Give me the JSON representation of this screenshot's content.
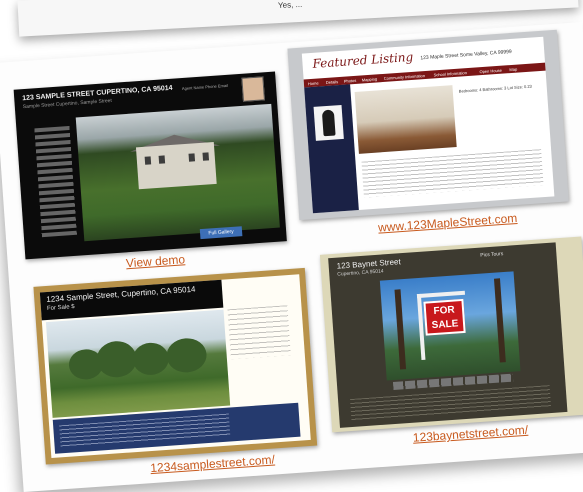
{
  "header_fragment": "Yes, ...",
  "screenshots": [
    {
      "id": "s1",
      "title": "123 SAMPLE STREET CUPERTINO, CA 95014",
      "subtitle": "Sample Street Cupertino, Sample Street",
      "agent_info": "Agent Name Phone Email",
      "gallery_button": "Full Gallery",
      "caption": "View demo"
    },
    {
      "id": "s2",
      "logo": "Featured Listing",
      "address": "123 Maple Street Some Valley, CA 99999",
      "nav": [
        "Home",
        "Details",
        "Photos",
        "Mapping",
        "Community Information",
        "School Information",
        "Open House",
        "Map"
      ],
      "details": "Bedrooms: 4  Bathrooms: 3  Lot Size: 0.23",
      "caption": "www.123MapleStreet.com"
    },
    {
      "id": "s3",
      "title": "1234 Sample Street, Cupertino, CA 95014",
      "subtitle": "For Sale $",
      "caption": "1234samplestreet.com/"
    },
    {
      "id": "s4",
      "title": "123 Baynet Street",
      "subtitle": "Cupertino, CA 95014",
      "menu": "Pics  Tours",
      "sign_text": "FOR SALE",
      "caption": "123baynetstreet.com/"
    }
  ]
}
